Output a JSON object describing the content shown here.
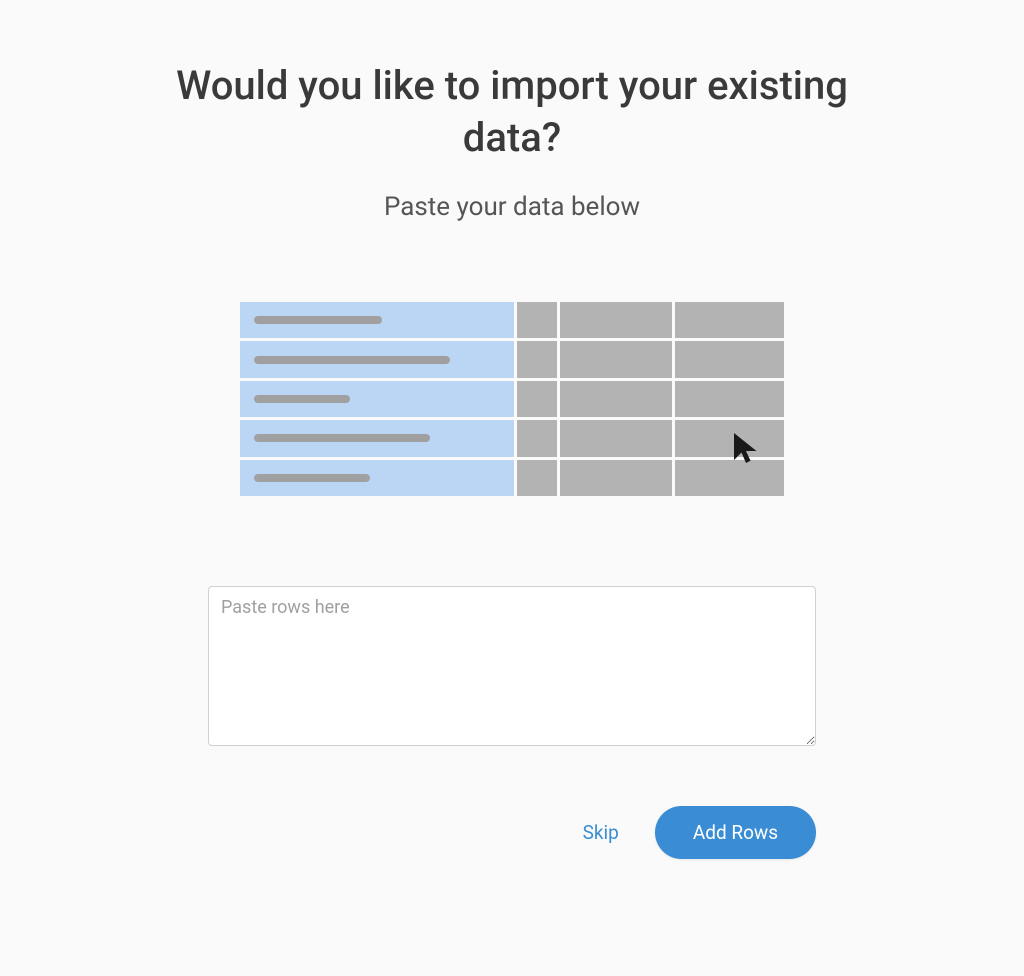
{
  "title": "Would you like to import your existing data?",
  "subtitle": "Paste your data below",
  "illustration": {
    "rows": [
      {
        "nameWidth": 128
      },
      {
        "nameWidth": 196
      },
      {
        "nameWidth": 96
      },
      {
        "nameWidth": 176
      },
      {
        "nameWidth": 116
      }
    ]
  },
  "textarea": {
    "placeholder": "Paste rows here",
    "value": ""
  },
  "buttons": {
    "skip": "Skip",
    "addRows": "Add Rows"
  }
}
